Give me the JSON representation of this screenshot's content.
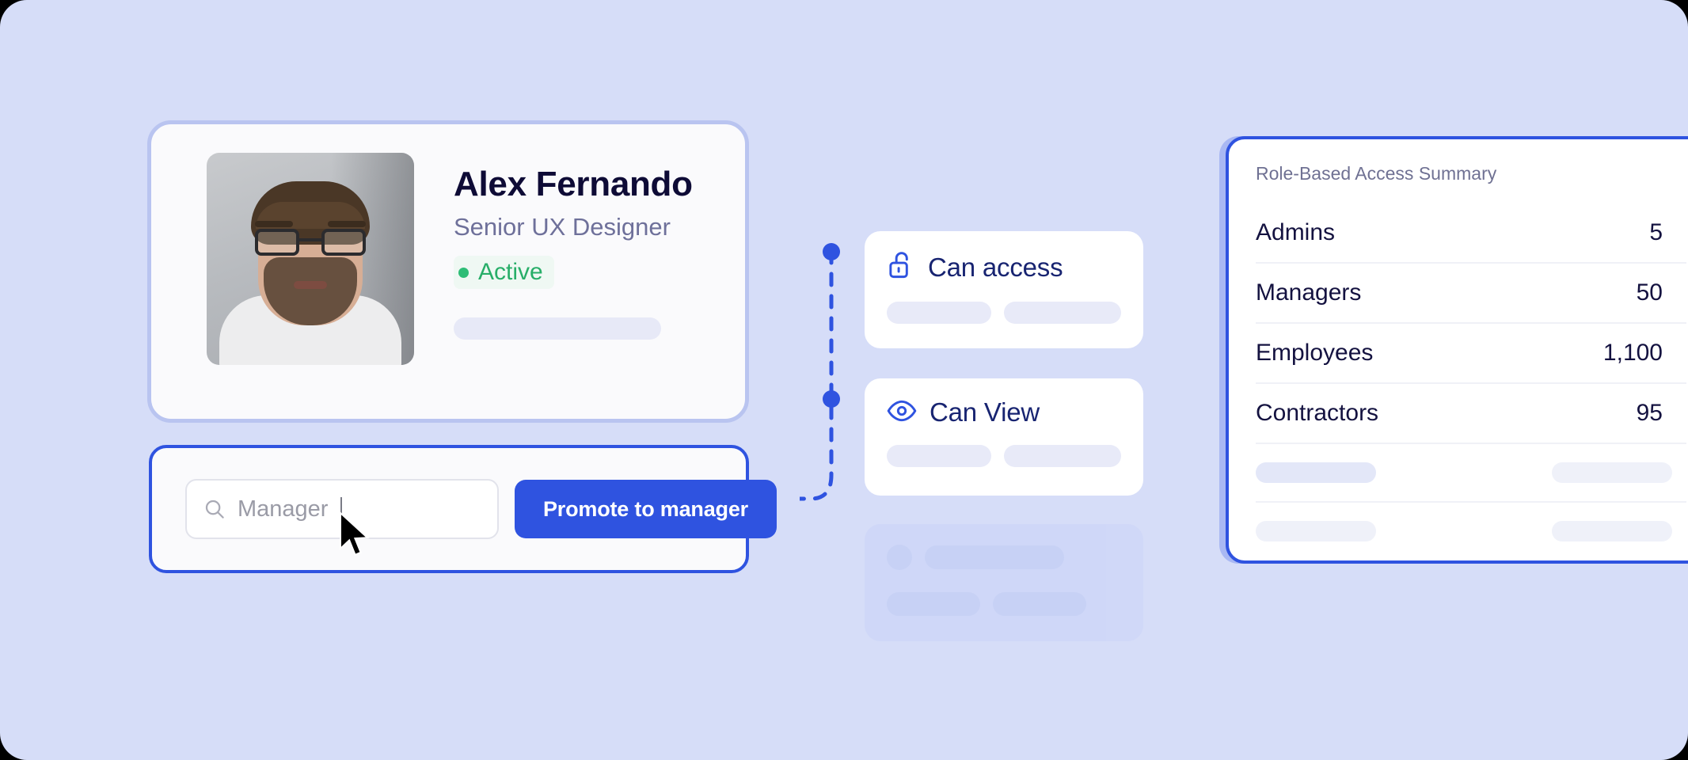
{
  "canvas": {
    "background": "#D6DDF8"
  },
  "profile": {
    "name": "Alex Fernando",
    "role": "Senior UX Designer",
    "status": "Active",
    "status_color": "#27AE68",
    "avatar_alt": "avatar-photo"
  },
  "promote": {
    "search_value": "Manager",
    "search_placeholder": "Manager",
    "search_icon": "search-icon",
    "button_label": "Promote to manager",
    "button_color": "#2F53E0"
  },
  "permissions": [
    {
      "icon": "unlock-icon",
      "title": "Can access"
    },
    {
      "icon": "eye-icon",
      "title": "Can View"
    }
  ],
  "summary": {
    "title": "Role-Based Access Summary",
    "rows": [
      {
        "label": "Admins",
        "value": "5"
      },
      {
        "label": "Managers",
        "value": "50"
      },
      {
        "label": "Employees",
        "value": "1,100"
      },
      {
        "label": "Contractors",
        "value": "95"
      }
    ]
  }
}
